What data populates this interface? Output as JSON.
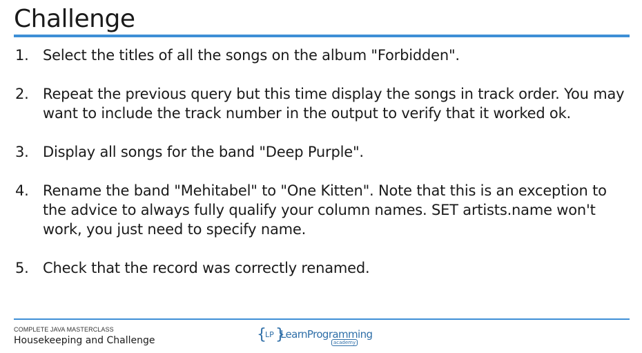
{
  "slide": {
    "title": "Challenge"
  },
  "challenges": [
    {
      "number": "1.",
      "text": "Select the titles of all the songs on the album \"Forbidden\"."
    },
    {
      "number": "2.",
      "text": "Repeat the previous query but this time display the songs in track order. You may want to include the track number in the output to verify that it worked ok."
    },
    {
      "number": "3.",
      "text": "Display all songs for the band \"Deep Purple\"."
    },
    {
      "number": "4.",
      "text": "Rename the band \"Mehitabel\" to \"One Kitten\". Note that this is an exception to the advice to always fully qualify your column names. SET artists.name won't work, you just need to specify name."
    },
    {
      "number": "5.",
      "text": "Check that the record was correctly renamed."
    }
  ],
  "footer": {
    "course": "COMPLETE JAVA MASTERCLASS",
    "section": "Housekeeping and Challenge"
  },
  "logo": {
    "brace_open": "{",
    "monogram": "LP",
    "brace_close": "}",
    "wordmark": "LearnProgramming",
    "tagline": "academy"
  },
  "colors": {
    "accent": "#3e8fd6",
    "logo": "#2f6fa8",
    "text": "#1a1a1a"
  }
}
